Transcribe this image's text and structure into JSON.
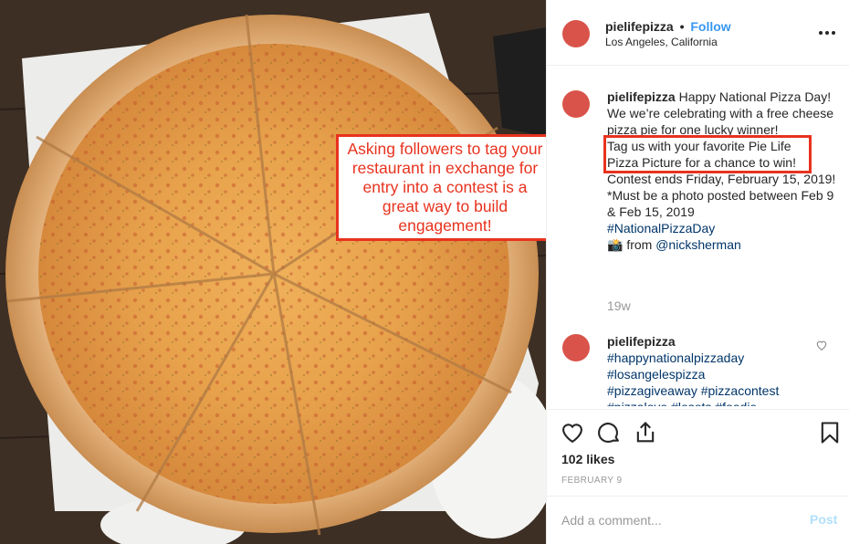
{
  "header": {
    "username": "pielifepizza",
    "separator": "•",
    "follow_label": "Follow",
    "location": "Los Angeles, California"
  },
  "annotation": {
    "text": "Asking followers to tag your restaurant in exchange for entry into a contest is a great way to build engagement!"
  },
  "caption": {
    "username": "pielifepizza",
    "line1": "Happy National Pizza Day!",
    "line2": "We we’re celebrating with a free cheese pizza pie for one lucky winner!",
    "highlight": "Tag us with your favorite Pie Life Pizza Picture for a chance to win!",
    "line3": "Contest ends Friday, February 15, 2019! *Must be a photo posted between Feb 9 & Feb 15, 2019",
    "hashtag": "#NationalPizzaDay",
    "camera": "📸",
    "from_text": "from",
    "mention": "@nicksherman",
    "time": "19w"
  },
  "comment": {
    "username": "pielifepizza",
    "tags": [
      "#happynationalpizzaday",
      "#losangelespizza",
      "#pizzagiveaway #pizzacontest",
      "#pizzalove #losots #foodie"
    ]
  },
  "actions": {
    "likes": "102 likes",
    "date": "FEBRUARY 9",
    "comment_placeholder": "Add a comment...",
    "post_label": "Post"
  },
  "colors": {
    "accent_red": "#e8321e",
    "link_blue": "#3897f0",
    "hashtag_navy": "#003569",
    "avatar": "#d9534a"
  },
  "icons": {
    "more": "more-options-icon",
    "like": "heart-icon",
    "comment": "comment-icon",
    "share": "share-icon",
    "save": "bookmark-icon",
    "comment_like": "small-heart-icon"
  }
}
